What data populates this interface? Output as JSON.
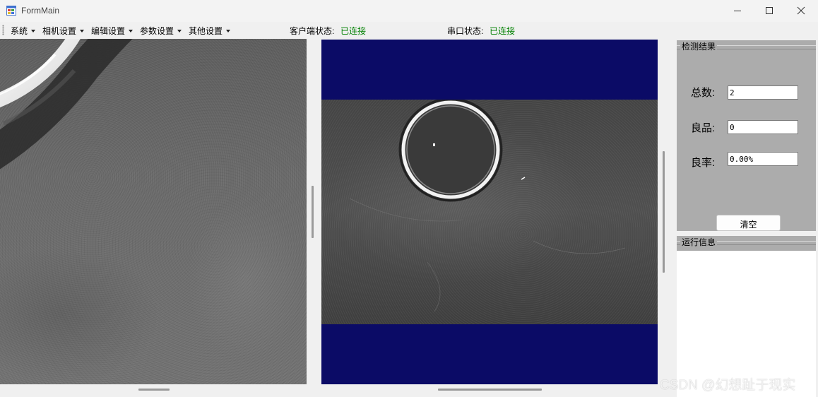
{
  "window": {
    "title": "FormMain",
    "icon": "app-window-icon",
    "controls": [
      "minimize-icon",
      "maximize-icon",
      "close-icon"
    ]
  },
  "menu": {
    "items": [
      {
        "label": "系统"
      },
      {
        "label": "相机设置"
      },
      {
        "label": "编辑设置"
      },
      {
        "label": "参数设置"
      },
      {
        "label": "其他设置"
      }
    ]
  },
  "status": {
    "client_label": "客户端状态:",
    "client_value": "已连接",
    "serial_label": "串口状态:",
    "serial_value": "已连接",
    "connected_color": "#008000"
  },
  "views": {
    "center_background_color": "#0b0b66"
  },
  "results": {
    "group_title": "检测结果",
    "total_label": "总数:",
    "total_value": "2",
    "good_label": "良品:",
    "good_value": "0",
    "rate_label": "良率:",
    "rate_value": "0.00%",
    "clear_button": "清空"
  },
  "info": {
    "group_title": "运行信息"
  },
  "watermark": "CSDN @幻想趾于现实"
}
